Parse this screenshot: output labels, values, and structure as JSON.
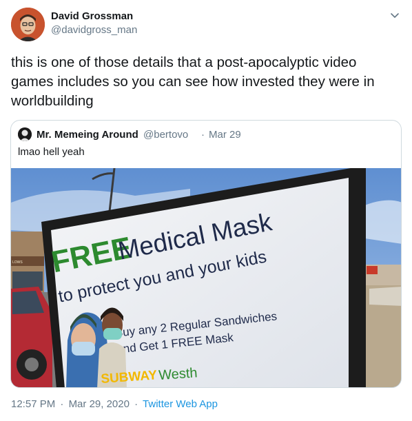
{
  "author": {
    "name": "David Grossman",
    "handle": "@davidgross_man"
  },
  "tweet": {
    "text": "this is one of those details that a post-apocalyptic video games includes so you can see how invested they were in worldbuilding"
  },
  "quoted": {
    "name": "Mr. Memeing Around",
    "handle": "@bertovo",
    "separator": "·",
    "date": "Mar 29",
    "text": "lmao hell yeah",
    "sign": {
      "free": "FREE",
      "medical_mask": "Medical Mask",
      "protect": "to protect you and your kids",
      "buy_line1": "Buy any 2 Regular Sandwiches",
      "buy_line2": "and Get 1 FREE Mask",
      "brand": "SUBWAY",
      "brand_suffix": "Westh",
      "store_sign": "LOWS"
    }
  },
  "footer": {
    "time": "12:57 PM",
    "sep1": "·",
    "date": "Mar 29, 2020",
    "sep2": "·",
    "source": "Twitter Web App"
  },
  "colors": {
    "link": "#1b95e0",
    "muted": "#657786",
    "sign_green": "#2d8a2f",
    "sign_navy": "#1f2a4a"
  },
  "icons": {
    "caret": "chevron-down-icon"
  }
}
